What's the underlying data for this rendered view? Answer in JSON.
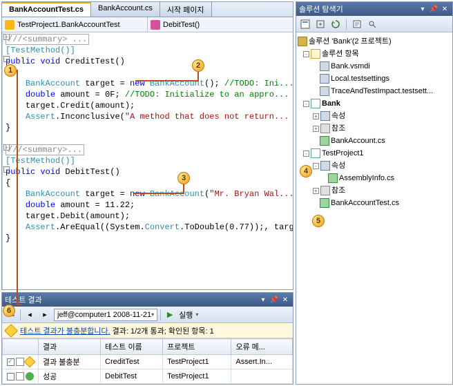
{
  "editor": {
    "tabs": [
      {
        "label": "BankAccountTest.cs",
        "active": true
      },
      {
        "label": "BankAccount.cs",
        "active": false
      },
      {
        "label": "시작 페이지",
        "active": false
      }
    ],
    "nav_left": "TestProject1.BankAccountTest",
    "nav_right": "DebitTest()",
    "code_segments": {
      "summary1": "///<summary> ...",
      "attr": "[TestMethod()]",
      "sig1_kw1": "public",
      "sig1_kw2": "void",
      "sig1_name": " CreditTest()",
      "brace_o": "{",
      "l1_type": "BankAccount",
      "l1_mid": " target = ",
      "l1_kw": "new",
      "l1_type2": " BankAccount",
      "l1_rest": "(); ",
      "l1_c": "//TODO: Ini...",
      "l2_kw": "double",
      "l2_mid": " amount = 0F; ",
      "l2_c": "//TODO: Initialize to an appro...",
      "l3": "target.Credit(amount);",
      "l4_type": "Assert",
      "l4_mid": ".Inconclusive(",
      "l4_str": "\"A method that does not return...",
      "brace_c": "}",
      "summary2": "///<summary>...",
      "sig2_kw1": "public",
      "sig2_kw2": "void",
      "sig2_name": " DebitTest()",
      "m1_type": "BankAccount",
      "m1_mid": " target = ",
      "m1_kw": "new",
      "m1_type2": " BankAccount",
      "m1_paren": "(",
      "m1_str": "\"Mr. Bryan Wal...",
      "m2_kw": "double",
      "m2_mid": " amount = 11.22;",
      "m3": "target.Debit(amount);",
      "m4_type": "Assert",
      "m4_mid1": ".AreEqual((System.",
      "m4_type2": "Convert",
      "m4_mid2": ".ToDouble(0.77));, targ..."
    }
  },
  "solution": {
    "title": "솔루션 탐색기",
    "root": "솔루션 'Bank'(2 프로젝트)",
    "items_folder": "솔루션 항목",
    "items": [
      "Bank.vsmdi",
      "Local.testsettings",
      "TraceAndTestImpact.testsett..."
    ],
    "proj1": "Bank",
    "proj1_props": "속성",
    "proj1_refs": "참조",
    "proj1_file": "BankAccount.cs",
    "proj2": "TestProject1",
    "proj2_props": "속성",
    "proj2_asm": "AssemblyInfo.cs",
    "proj2_refs": "참조",
    "proj2_file": "BankAccountTest.cs"
  },
  "results": {
    "title": "테스트 결과",
    "combo": "jeff@computer1 2008-11-21",
    "run_label": "실행",
    "status_link": "테스트 결과가 불충분합니다.",
    "status_text": " 결과: 1/2개 통과; 확인된 항목: 1",
    "cols": {
      "c0": "",
      "c1": "결과",
      "c2": "테스트 이름",
      "c3": "프로젝트",
      "c4": "오류 메..."
    },
    "rows": [
      {
        "result": "결과 불충분",
        "name": "CreditTest",
        "project": "TestProject1",
        "err": "Assert.In...",
        "status": "warn",
        "checked": true
      },
      {
        "result": "성공",
        "name": "DebitTest",
        "project": "TestProject1",
        "err": "",
        "status": "pass",
        "checked": false
      }
    ]
  },
  "callouts": [
    "1",
    "2",
    "3",
    "4",
    "5",
    "6"
  ]
}
